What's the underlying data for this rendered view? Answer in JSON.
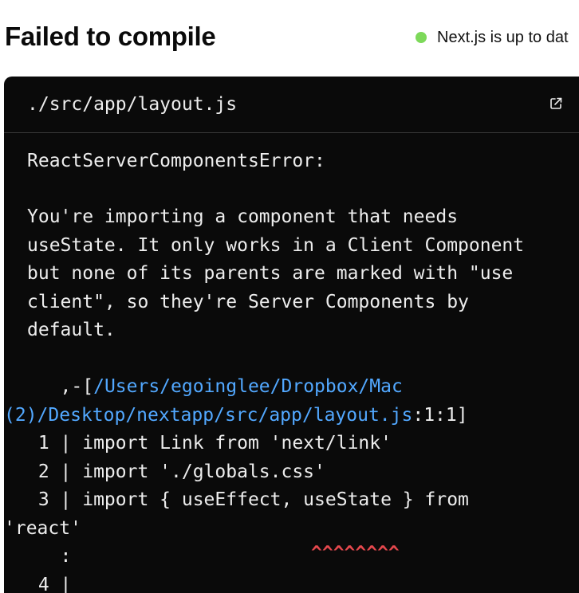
{
  "header": {
    "title": "Failed to compile",
    "status_text": "Next.js is up to dat",
    "status_color": "#7dd95a"
  },
  "error_panel": {
    "file_path": "./src/app/layout.js",
    "open_icon": "external-link-icon",
    "error_type": "ReactServerComponentsError:",
    "message_lines": [
      "You're importing a component that needs",
      "useState. It only works in a Client Component",
      "but none of its parents are marked with \"use",
      "client\", so they're Server Components by",
      "default."
    ],
    "location_prefix": "   ,-[",
    "location_path_part1": "/Users/egoinglee/Dropbox/Mac",
    "location_path_part2": "(2)/Desktop/nextapp/src/app/layout.js",
    "location_suffix": ":1:1]",
    "code_lines": [
      " 1 | import Link from 'next/link'",
      " 2 | import './globals.css'",
      " 3 | import { useEffect, useState } from",
      "'react'",
      "   :",
      " 4 |"
    ],
    "underline": "^^^^^^^^",
    "link_color": "#52a8ff",
    "squiggle_color": "#e5484d"
  }
}
